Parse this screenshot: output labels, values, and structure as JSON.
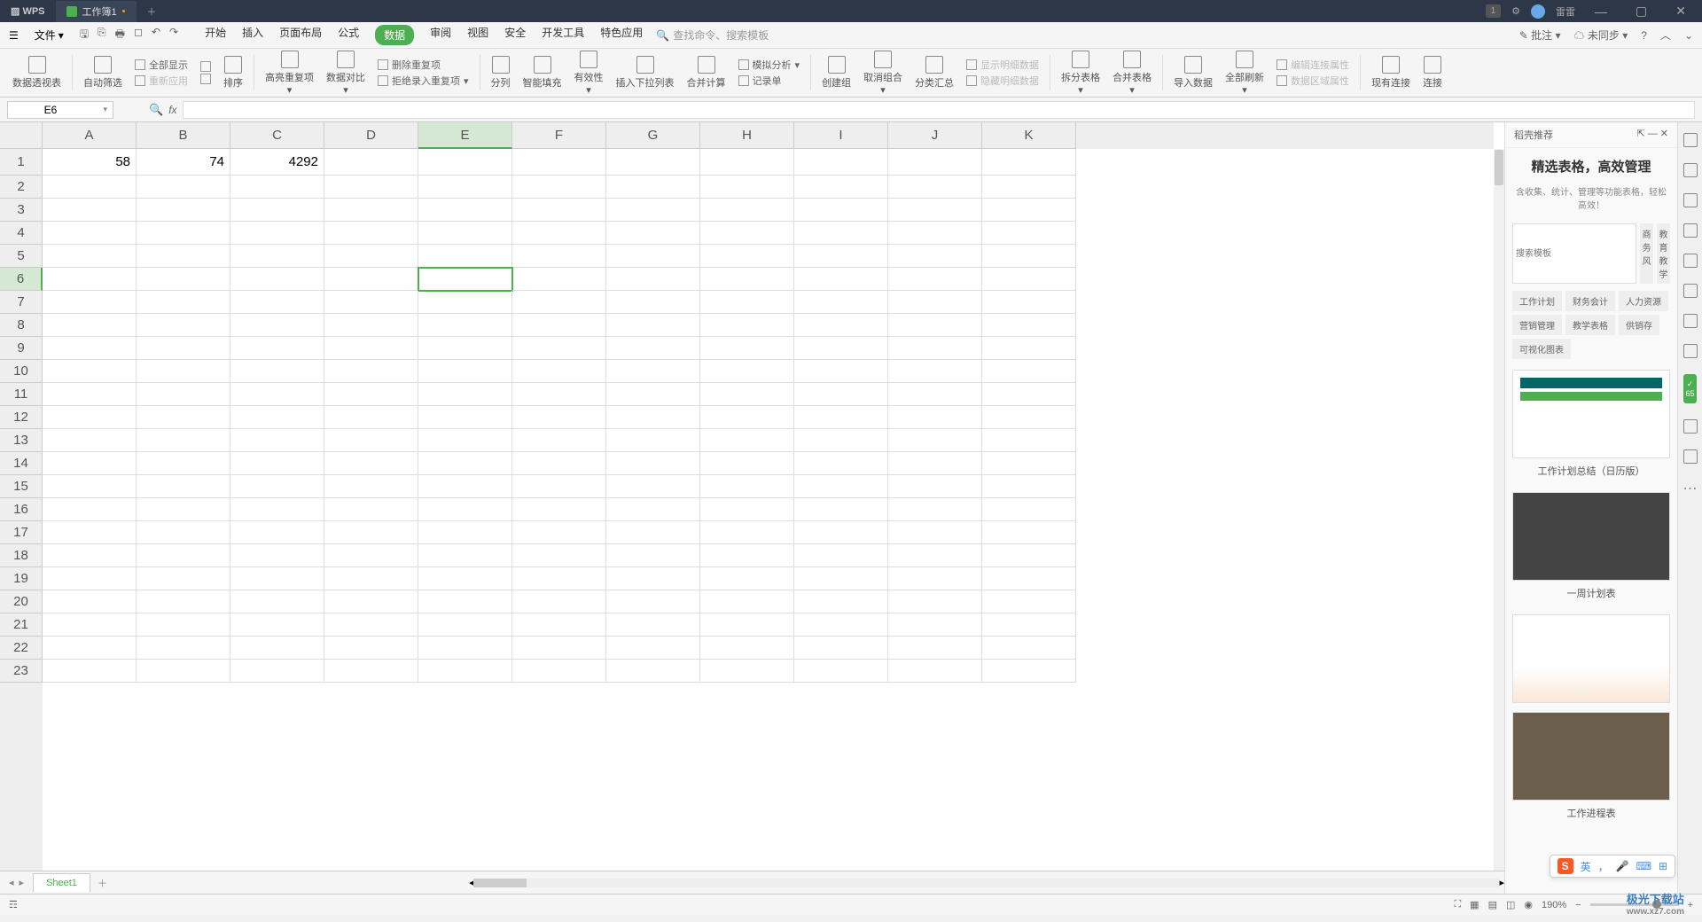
{
  "titlebar": {
    "app": "WPS",
    "tab": "工作簿1",
    "user": "雷雷",
    "badge": "1"
  },
  "menubar": {
    "file": "文件",
    "tabs": [
      "开始",
      "插入",
      "页面布局",
      "公式",
      "数据",
      "审阅",
      "视图",
      "安全",
      "开发工具",
      "特色应用"
    ],
    "activeTab": "数据",
    "search": "查找命令、搜索模板",
    "annotate": "批注",
    "unsync": "未同步"
  },
  "ribbon": {
    "items": [
      "数据透视表",
      "自动筛选",
      "排序",
      "高亮重复项",
      "数据对比",
      "分列",
      "智能填充",
      "有效性",
      "插入下拉列表",
      "合并计算",
      "创建组",
      "取消组合",
      "分类汇总",
      "拆分表格",
      "合并表格",
      "导入数据",
      "全部刷新",
      "现有连接",
      "连接"
    ],
    "small1a": "全部显示",
    "small1b": "重新应用",
    "small2a": "删除重复项",
    "small2b": "拒绝录入重复项",
    "small3a": "模拟分析",
    "small3b": "记录单",
    "small4a": "显示明细数据",
    "small4b": "隐藏明细数据",
    "small5a": "编辑连接属性",
    "small5b": "数据区域属性"
  },
  "formula": {
    "namebox": "E6",
    "fx": "fx"
  },
  "grid": {
    "cols": [
      "A",
      "B",
      "C",
      "D",
      "E",
      "F",
      "G",
      "H",
      "I",
      "J",
      "K"
    ],
    "rows": 23,
    "activeCol": 4,
    "activeRow": 5,
    "data": {
      "r0c0": "58",
      "r0c1": "74",
      "r0c2": "4292"
    }
  },
  "sheets": {
    "active": "Sheet1"
  },
  "rpanel": {
    "head": "稻壳推荐",
    "title": "精选表格，高效管理",
    "sub": "含收集、统计、管理等功能表格，轻松高效！",
    "searchPlaceholder": "搜索模板",
    "tab2": "商务风",
    "tab3": "教育教学",
    "cats": [
      "工作计划",
      "财务会计",
      "人力资源",
      "营销管理",
      "教学表格",
      "供销存",
      "可视化图表"
    ],
    "tmpl1": "工作计划总结（日历版）",
    "tmpl2": "一周计划表",
    "tmpl3": "工作进程表"
  },
  "rside": {
    "badge": "65"
  },
  "status": {
    "zoom": "190%"
  },
  "ime": {
    "lang": "英",
    "comma": "，"
  },
  "watermark": {
    "main": "极光下载站",
    "sub": "www.xz7.com"
  }
}
